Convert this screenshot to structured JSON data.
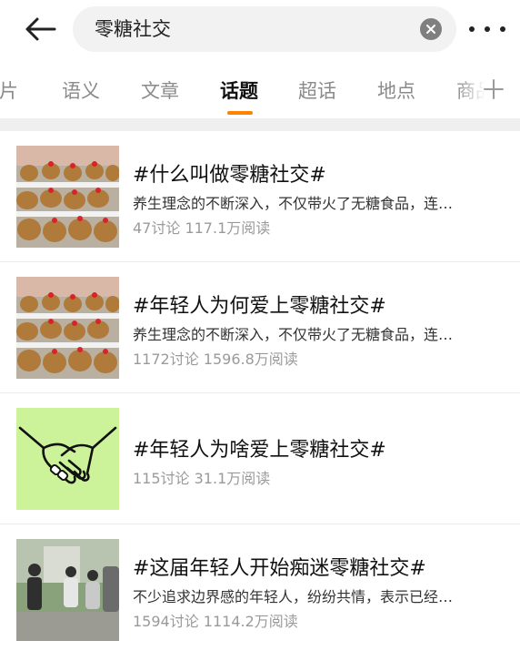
{
  "search": {
    "query": "零糖社交"
  },
  "tabs": [
    {
      "label": "图片"
    },
    {
      "label": "语义"
    },
    {
      "label": "文章"
    },
    {
      "label": "话题",
      "active": true
    },
    {
      "label": "超话"
    },
    {
      "label": "地点"
    },
    {
      "label": "商品"
    }
  ],
  "topics": [
    {
      "title": "#什么叫做零糖社交#",
      "desc": "养生理念的不断深入，不仅带火了无糖食品，连…",
      "stats": "47讨论 117.1万阅读",
      "thumb": "capybara-plush-photo"
    },
    {
      "title": "#年轻人为何爱上零糖社交#",
      "desc": "养生理念的不断深入，不仅带火了无糖食品，连…",
      "stats": "1172讨论 1596.8万阅读",
      "thumb": "capybara-plush-photo"
    },
    {
      "title": "#年轻人为啥爱上零糖社交#",
      "desc": "",
      "stats": "115讨论 31.1万阅读",
      "thumb": "handshake-illustration"
    },
    {
      "title": "#这届年轻人开始痴迷零糖社交#",
      "desc": "不少追求边界感的年轻人，纷纷共情，表示已经…",
      "stats": "1594讨论 1114.2万阅读",
      "thumb": "people-outdoor-photo"
    }
  ],
  "colors": {
    "accent": "#ff8200",
    "tab_active": "#111111",
    "tab_inactive": "#8a8a8a",
    "stats": "#9a9a9a",
    "handshake_bg": "#ccf29a"
  },
  "icons": {
    "back": "arrow-left-icon",
    "clear": "close-circle-icon",
    "more": "more-dots-icon",
    "add": "plus-icon"
  }
}
